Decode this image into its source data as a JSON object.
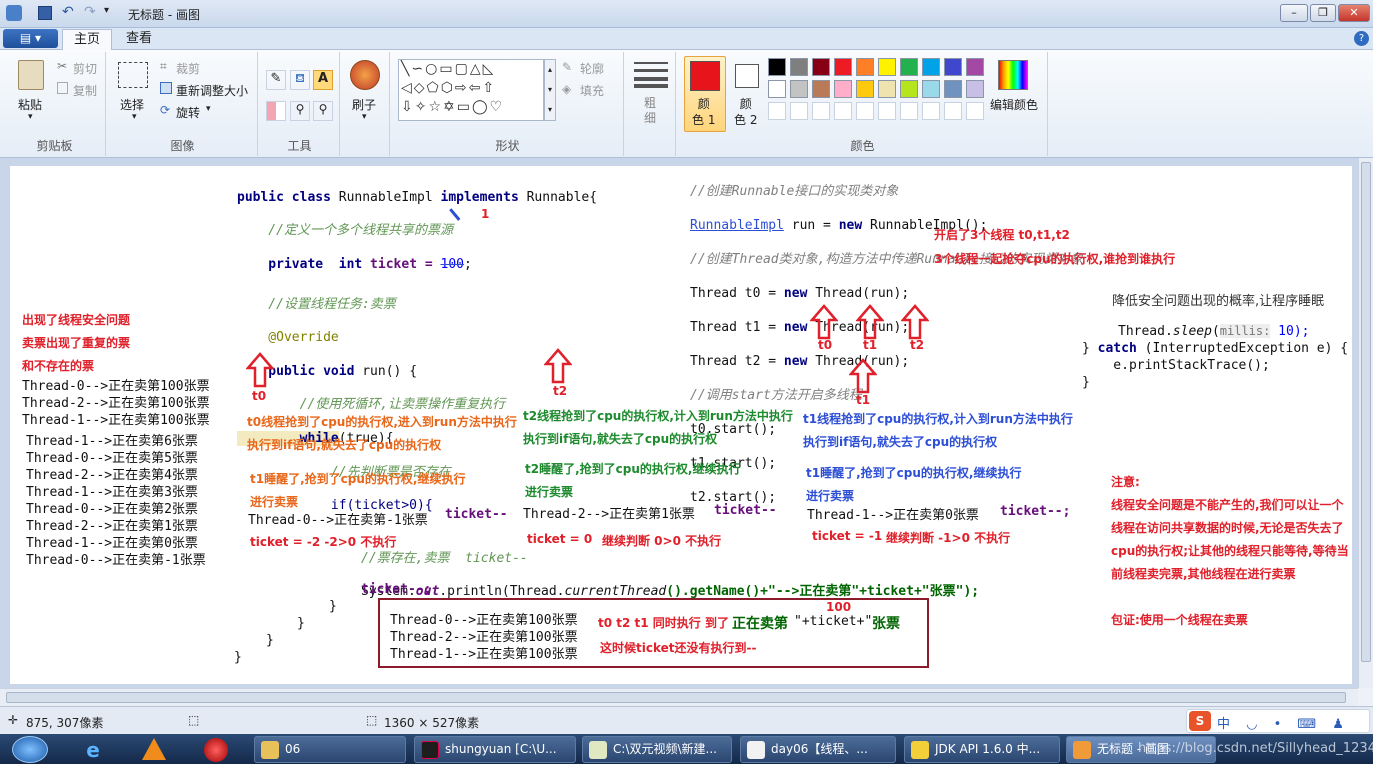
{
  "window": {
    "title": "无标题 - 画图"
  },
  "ribbon_tabs": {
    "home": "主页",
    "view": "查看"
  },
  "clipboard": {
    "paste": "粘贴",
    "cut": "剪切",
    "copy": "复制",
    "group": "剪贴板"
  },
  "image": {
    "select": "选择",
    "crop": "裁剪",
    "resize": "重新调整大小",
    "rotate": "旋转",
    "group": "图像"
  },
  "tools": {
    "group": "工具"
  },
  "brushes": {
    "label": "刷子"
  },
  "shapes": {
    "outline": "轮廓",
    "fill": "填充",
    "group": "形状"
  },
  "size": {
    "label": "粗\n细"
  },
  "colors": {
    "color1": "颜\n色 1",
    "color2": "颜\n色 2",
    "edit": "编辑颜色",
    "group": "颜色",
    "color1_value": "#e8141c",
    "color2_value": "#ffffff",
    "palette_row1": [
      "#000000",
      "#7f7f7f",
      "#880015",
      "#ed1c24",
      "#ff7f27",
      "#fff200",
      "#22b14c",
      "#00a2e8",
      "#3f48cc",
      "#a349a4"
    ],
    "palette_row2": [
      "#ffffff",
      "#c3c3c3",
      "#b97a57",
      "#ffaec9",
      "#ffc90e",
      "#efe4b0",
      "#b5e61d",
      "#99d9ea",
      "#7092be",
      "#c8bfe7"
    ]
  },
  "code": {
    "l1a": "public class",
    "l1b": " RunnableImpl ",
    "l1c": "implements",
    "l1d": " Runnable{",
    "l2": "    //定义一个多个线程共享的票源",
    "l3a": "    private  int",
    "l3b": " ticket = ",
    "l3c": "100",
    "l3d": ";",
    "l4": "    //设置线程任务:卖票",
    "l5": "    @Override",
    "l6a": "    public void",
    "l6b": " run() {",
    "l7": "        //使用死循环,让卖票操作重复执行",
    "l8a": "        while",
    "l8b": "(true){",
    "l9": "            //先判断票是否存在",
    "l10": "            if(ticket>0){",
    "l11": "//票存在,卖票  ticket--",
    "l12a": "System.",
    "l12b": "out",
    "l12c": ".println(Thread.",
    "l12d": "currentThread",
    "l12e": "().getName()+\"-->",
    "l12f": "正在卖第",
    "l12g": "\"+ticket+\"",
    "l12h": "张票",
    "l12i": "\");",
    "l13": "ticket--;",
    "c1": "}",
    "c2": "}",
    "c3": "}",
    "c4": "}"
  },
  "main_code": {
    "m1": "//创建Runnable接口的实现类对象",
    "m2a": "RunnableImpl",
    "m2b": " run = ",
    "m2c": "new",
    "m2d": " RunnableImpl();",
    "m3": "//创建Thread类对象,构造方法中传递Runnable接口的实现类对象",
    "m4a": "Thread t0 = ",
    "m4b": "new",
    "m4c": " Thread(run);",
    "m5a": "Thread t1 = ",
    "m5b": "new",
    "m5c": " Thread(run);",
    "m6a": "Thread t2 = ",
    "m6b": "new",
    "m6c": " Thread(run);",
    "m7": "//调用start方法开启多线程",
    "m8": "t0.start();",
    "m9": "t1.start();",
    "m10": "t2.start();"
  },
  "sleep_code": {
    "s1": "降低安全问题出现的概率,让程序睡眠",
    "s2a": "Thread.",
    "s2b": "sleep",
    "s2c": "(",
    "s2d": "millis:",
    "s2e": " 10);",
    "s3a": "} ",
    "s3b": "catch",
    "s3c": " (InterruptedException e) {",
    "s4": "    e.printStackTrace();",
    "s5": "}"
  },
  "notes": {
    "one": "1",
    "started": "开启了3个线程 t0,t1,t2",
    "compete": "3个线程一起抢夺cpu的执行权,谁抢到谁执行",
    "problem1": "出现了线程安全问题",
    "problem2": "卖票出现了重复的票",
    "problem3": "和不存在的票",
    "t0": "t0",
    "t1": "t1",
    "t2": "t2",
    "t0_a": "t0线程抢到了cpu的执行权,进入到run方法中执行",
    "t0_b": "执行到if语句,就失去了cpu的执行权",
    "t0_c": "t1睡醒了,抢到了cpu的执行权,继续执行",
    "t0_d": "进行卖票",
    "t0_e": "Thread-0-->正在卖第-1张票",
    "t0_f": "ticket--",
    "t0_g": "ticket = -2  -2>0 不执行",
    "t2_a": "t2线程抢到了cpu的执行权,计入到run方法中执行",
    "t2_b": "执行到if语句,就失去了cpu的执行权",
    "t2_c": "t2睡醒了,抢到了cpu的执行权,继续执行",
    "t2_d": "进行卖票",
    "t2_e": "Thread-2-->正在卖第1张票",
    "t2_f": "ticket--",
    "t2_g": "ticket = 0",
    "t2_h": "继续判断 0>0 不执行",
    "t1_a": "t1线程抢到了cpu的执行权,计入到run方法中执行",
    "t1_b": "执行到if语句,就失去了cpu的执行权",
    "t1_c": "t1睡醒了,抢到了cpu的执行权,继续执行",
    "t1_d": "进行卖票",
    "t1_e": "Thread-1-->正在卖第0张票",
    "t1_f": "ticket--;",
    "t1_g": "ticket = -1",
    "t1_h": "继续判断 -1>0 不执行",
    "box_100": "100",
    "box_note1": "t0 t2 t1 同时执行 到了",
    "box_note2": "正在卖第",
    "box_note3": "\"+ticket+\"",
    "box_note4": "张票",
    "box_note5": "这时候ticket还没有执行到--",
    "attention": "注意:",
    "att1": "线程安全问题是不能产生的,我们可以让一个",
    "att2": "线程在访问共享数据的时候,无论是否失去了",
    "att3": "cpu的执行权;让其他的线程只能等待,等待当",
    "att4": "前线程卖完票,其他线程在进行卖票",
    "guarantee": "包证:使用一个线程在卖票"
  },
  "output_list": [
    "Thread-0-->正在卖第100张票",
    "Thread-2-->正在卖第100张票",
    "Thread-1-->正在卖第100张票",
    "Thread-1-->正在卖第6张票",
    "Thread-0-->正在卖第5张票",
    "Thread-2-->正在卖第4张票",
    "Thread-1-->正在卖第3张票",
    "Thread-0-->正在卖第2张票",
    "Thread-2-->正在卖第1张票",
    "Thread-1-->正在卖第0张票",
    "Thread-0-->正在卖第-1张票"
  ],
  "box_lines": [
    "Thread-0-->正在卖第100张票",
    "Thread-2-->正在卖第100张票",
    "Thread-1-->正在卖第100张票"
  ],
  "status": {
    "cursor": "875, 307像素",
    "canvas_size": "1360 × 527像素"
  },
  "taskbar": {
    "t1": "06",
    "t2": "shungyuan [C:\\U...",
    "t3": "C:\\双元视频\\新建...",
    "t4": "day06【线程、...",
    "t5": "JDK API 1.6.0 中...",
    "t6": "无标题 - 画图",
    "watermark": "https://blog.csdn.net/Sillyhead_1234"
  }
}
